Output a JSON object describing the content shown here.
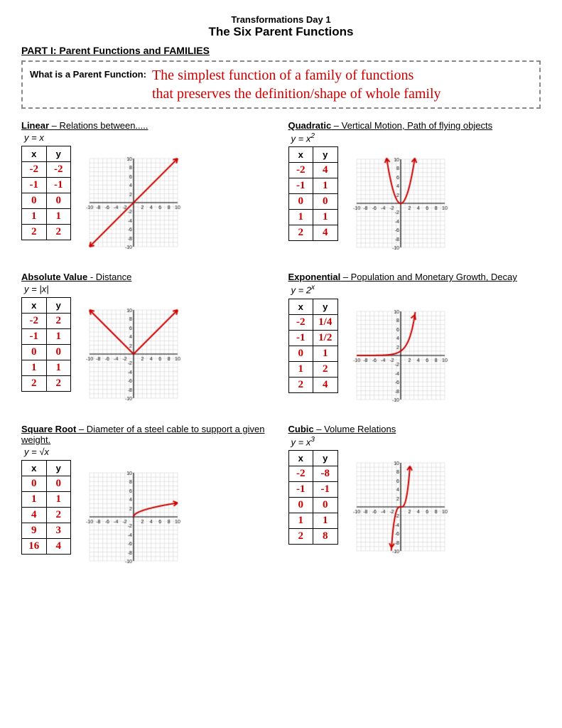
{
  "header": {
    "subtitle": "Transformations Day 1",
    "title": "The Six Parent Functions"
  },
  "part1": {
    "label": "PART I: Parent Functions and FAMILIES",
    "what_is_label": "What is a Parent Function:",
    "what_is_def_line1": "The simplest function of a family of functions",
    "what_is_def_line2": "that preserves the definition/shape of whole family"
  },
  "functions": [
    {
      "id": "linear",
      "title": "Linear",
      "title_suffix": " – Relations between.....",
      "equation": "y = x",
      "table": {
        "headers": [
          "x",
          "y"
        ],
        "rows": [
          [
            "-2",
            "-2"
          ],
          [
            "-1",
            "-1"
          ],
          [
            "0",
            "0"
          ],
          [
            "1",
            "1"
          ],
          [
            "2",
            "2"
          ]
        ]
      },
      "graph": {
        "type": "linear",
        "slope": 1,
        "intercept": 0
      }
    },
    {
      "id": "quadratic",
      "title": "Quadratic",
      "title_suffix": " – Vertical Motion, Path of flying objects",
      "equation": "y = x²",
      "table": {
        "headers": [
          "x",
          "y"
        ],
        "rows": [
          [
            "-2",
            "4"
          ],
          [
            "-1",
            "1"
          ],
          [
            "0",
            "0"
          ],
          [
            "1",
            "1"
          ],
          [
            "2",
            "4"
          ]
        ]
      },
      "graph": {
        "type": "quadratic"
      }
    },
    {
      "id": "absolute_value",
      "title": "Absolute Value",
      "title_suffix": " - Distance",
      "equation": "y = |x|",
      "table": {
        "headers": [
          "x",
          "y"
        ],
        "rows": [
          [
            "-2",
            "2"
          ],
          [
            "-1",
            "1"
          ],
          [
            "0",
            "0"
          ],
          [
            "1",
            "1"
          ],
          [
            "2",
            "2"
          ]
        ]
      },
      "graph": {
        "type": "absolute"
      }
    },
    {
      "id": "exponential",
      "title": "Exponential",
      "title_suffix": " – Population and Monetary Growth, Decay",
      "equation": "y = 2ˣ",
      "table": {
        "headers": [
          "x",
          "y"
        ],
        "rows": [
          [
            "-2",
            "1/4"
          ],
          [
            "-1",
            "1/2"
          ],
          [
            "0",
            "1"
          ],
          [
            "1",
            "2"
          ],
          [
            "2",
            "4"
          ]
        ]
      },
      "graph": {
        "type": "exponential"
      }
    },
    {
      "id": "square_root",
      "title": "Square Root",
      "title_suffix": " – Diameter of a steel cable to support a given weight.",
      "equation": "y = √x",
      "table": {
        "headers": [
          "x",
          "y"
        ],
        "rows": [
          [
            "0",
            "0"
          ],
          [
            "1",
            "1"
          ],
          [
            "4",
            "2"
          ],
          [
            "9",
            "3"
          ],
          [
            "16",
            "4"
          ]
        ]
      },
      "graph": {
        "type": "sqrt"
      }
    },
    {
      "id": "cubic",
      "title": "Cubic",
      "title_suffix": " – Volume Relations",
      "equation": "y = x³",
      "table": {
        "headers": [
          "x",
          "y"
        ],
        "rows": [
          [
            "-2",
            "-8"
          ],
          [
            "-1",
            "-1"
          ],
          [
            "0",
            "0"
          ],
          [
            "1",
            "1"
          ],
          [
            "2",
            "8"
          ]
        ]
      },
      "graph": {
        "type": "cubic"
      }
    }
  ]
}
